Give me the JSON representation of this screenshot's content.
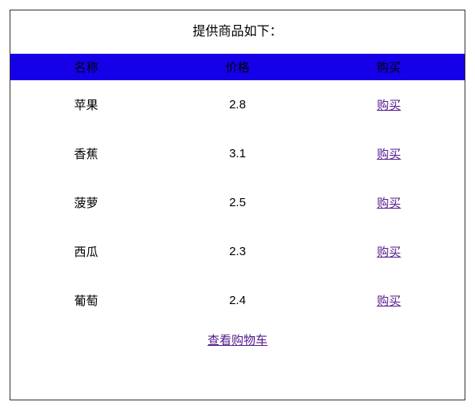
{
  "title": "提供商品如下：",
  "headers": {
    "name": "名称",
    "price": "价格",
    "buy": "购买"
  },
  "rows": [
    {
      "name": "苹果",
      "price": "2.8",
      "buy": "购买"
    },
    {
      "name": "香蕉",
      "price": "3.1",
      "buy": "购买"
    },
    {
      "name": "菠萝",
      "price": "2.5",
      "buy": "购买"
    },
    {
      "name": "西瓜",
      "price": "2.3",
      "buy": "购买"
    },
    {
      "name": "葡萄",
      "price": "2.4",
      "buy": "购买"
    }
  ],
  "view_cart": "查看购物车"
}
